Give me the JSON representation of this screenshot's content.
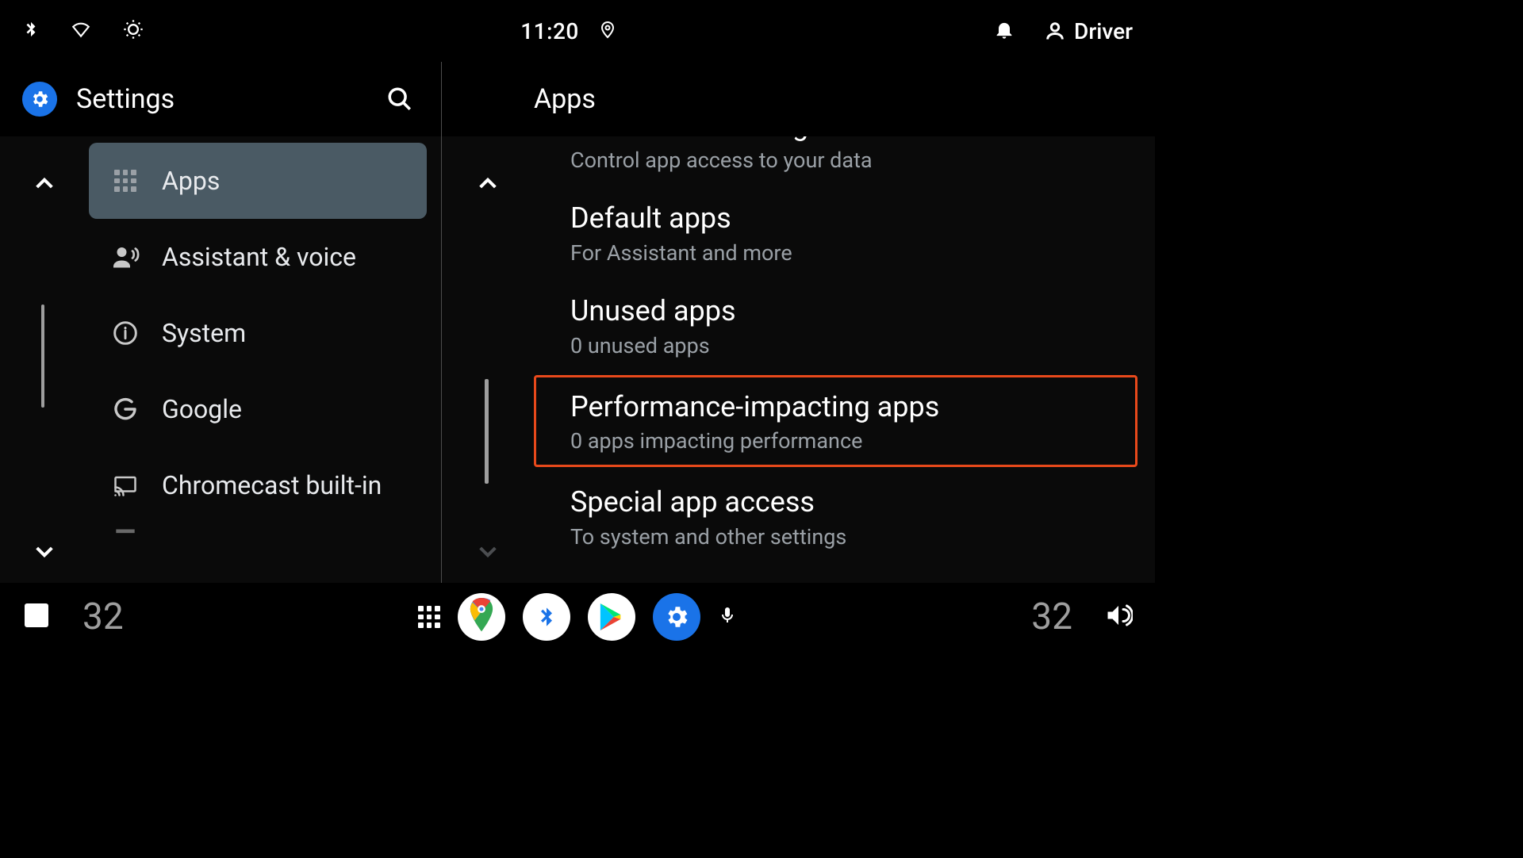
{
  "status": {
    "time": "11:20",
    "user_name": "Driver"
  },
  "left": {
    "title": "Settings",
    "items": [
      {
        "label": "Apps"
      },
      {
        "label": "Assistant & voice"
      },
      {
        "label": "System"
      },
      {
        "label": "Google"
      },
      {
        "label": "Chromecast built-in"
      }
    ]
  },
  "right": {
    "title": "Apps",
    "items": [
      {
        "title": "Permission manager",
        "sub": "Control app access to your data"
      },
      {
        "title": "Default apps",
        "sub": "For Assistant and more"
      },
      {
        "title": "Unused apps",
        "sub": "0 unused apps"
      },
      {
        "title": "Performance-impacting apps",
        "sub": "0 apps impacting performance"
      },
      {
        "title": "Special app access",
        "sub": "To system and other settings"
      }
    ]
  },
  "navbar": {
    "temp_left": "32",
    "temp_right": "32"
  }
}
